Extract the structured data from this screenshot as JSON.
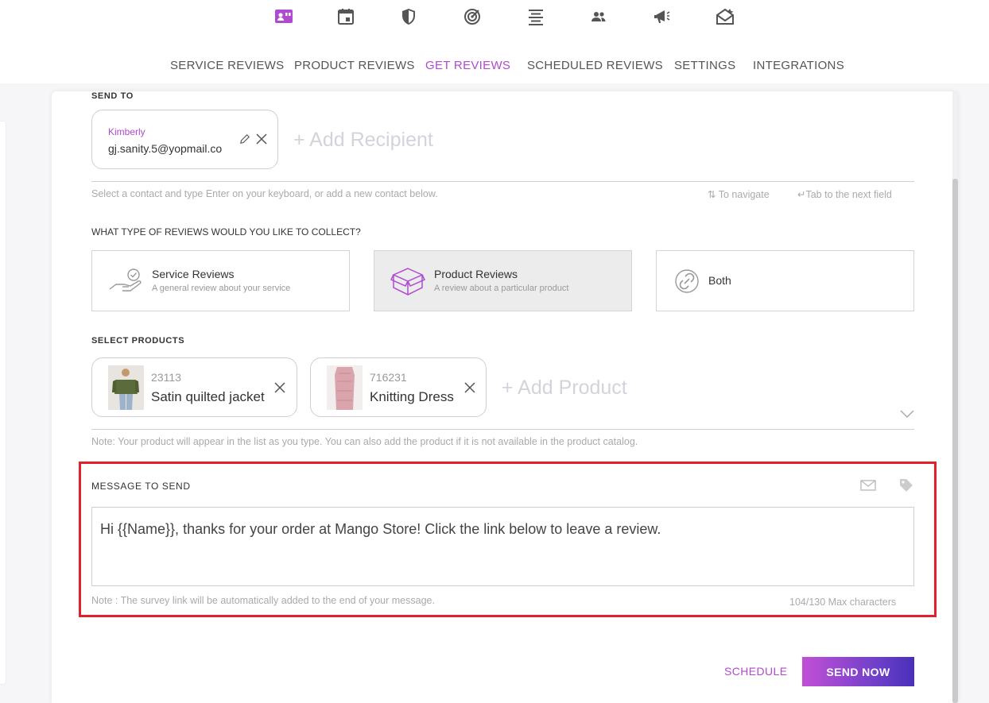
{
  "top_icons": [
    {
      "name": "reviews-icon",
      "color": "#b04ad0",
      "active": true
    },
    {
      "name": "calendar-icon",
      "color": "#555555"
    },
    {
      "name": "shield-icon",
      "color": "#555555"
    },
    {
      "name": "target-icon",
      "color": "#555555"
    },
    {
      "name": "align-center-icon",
      "color": "#555555"
    },
    {
      "name": "people-icon",
      "color": "#555555"
    },
    {
      "name": "megaphone-icon",
      "color": "#555555"
    },
    {
      "name": "open-mail-icon",
      "color": "#555555"
    }
  ],
  "tabs": [
    {
      "label": "SERVICE REVIEWS"
    },
    {
      "label": "PRODUCT REVIEWS"
    },
    {
      "label": "GET REVIEWS",
      "active": true
    },
    {
      "label": "SCHEDULED REVIEWS"
    },
    {
      "label": "SETTINGS"
    },
    {
      "label": "INTEGRATIONS"
    }
  ],
  "send_to": {
    "label": "SEND TO",
    "recipient": {
      "name": "Kimberly",
      "email": "gj.sanity.5@yopmail.co"
    },
    "add_placeholder": "+ Add Recipient",
    "hint": "Select a contact and type Enter on your keyboard, or add a new contact below.",
    "nav_hint": "To navigate",
    "tab_hint": "Tab to the next field"
  },
  "review_type": {
    "question": "WHAT TYPE OF REVIEWS WOULD YOU LIKE TO COLLECT?",
    "options": [
      {
        "title": "Service Reviews",
        "subtitle": "A general review about your service"
      },
      {
        "title": "Product Reviews",
        "subtitle": "A review about a particular product",
        "selected": true
      },
      {
        "title": "Both",
        "subtitle": ""
      }
    ]
  },
  "products": {
    "label": "SELECT PRODUCTS",
    "items": [
      {
        "sku": "23113",
        "name": "Satin quilted jacket"
      },
      {
        "sku": "716231",
        "name": "Knitting Dress"
      }
    ],
    "add_placeholder": "+ Add Product",
    "note": "Note: Your product will appear in the list as you type. You can also add the product if it is not available in the product catalog."
  },
  "message": {
    "label": "MESSAGE TO SEND",
    "text": "Hi {{Name}}, thanks for your order at Mango Store! Click the link below to leave a review.",
    "note": "Note : The survey link will be automatically added to the end of your message.",
    "counter": "104/130 Max characters"
  },
  "actions": {
    "schedule_label": "SCHEDULE",
    "send_label": "SEND NOW"
  },
  "colors": {
    "accent": "#b04ad0",
    "highlight": "#e2202b",
    "button_gradient_start": "#c24fd6",
    "button_gradient_end": "#4a2fb8"
  }
}
